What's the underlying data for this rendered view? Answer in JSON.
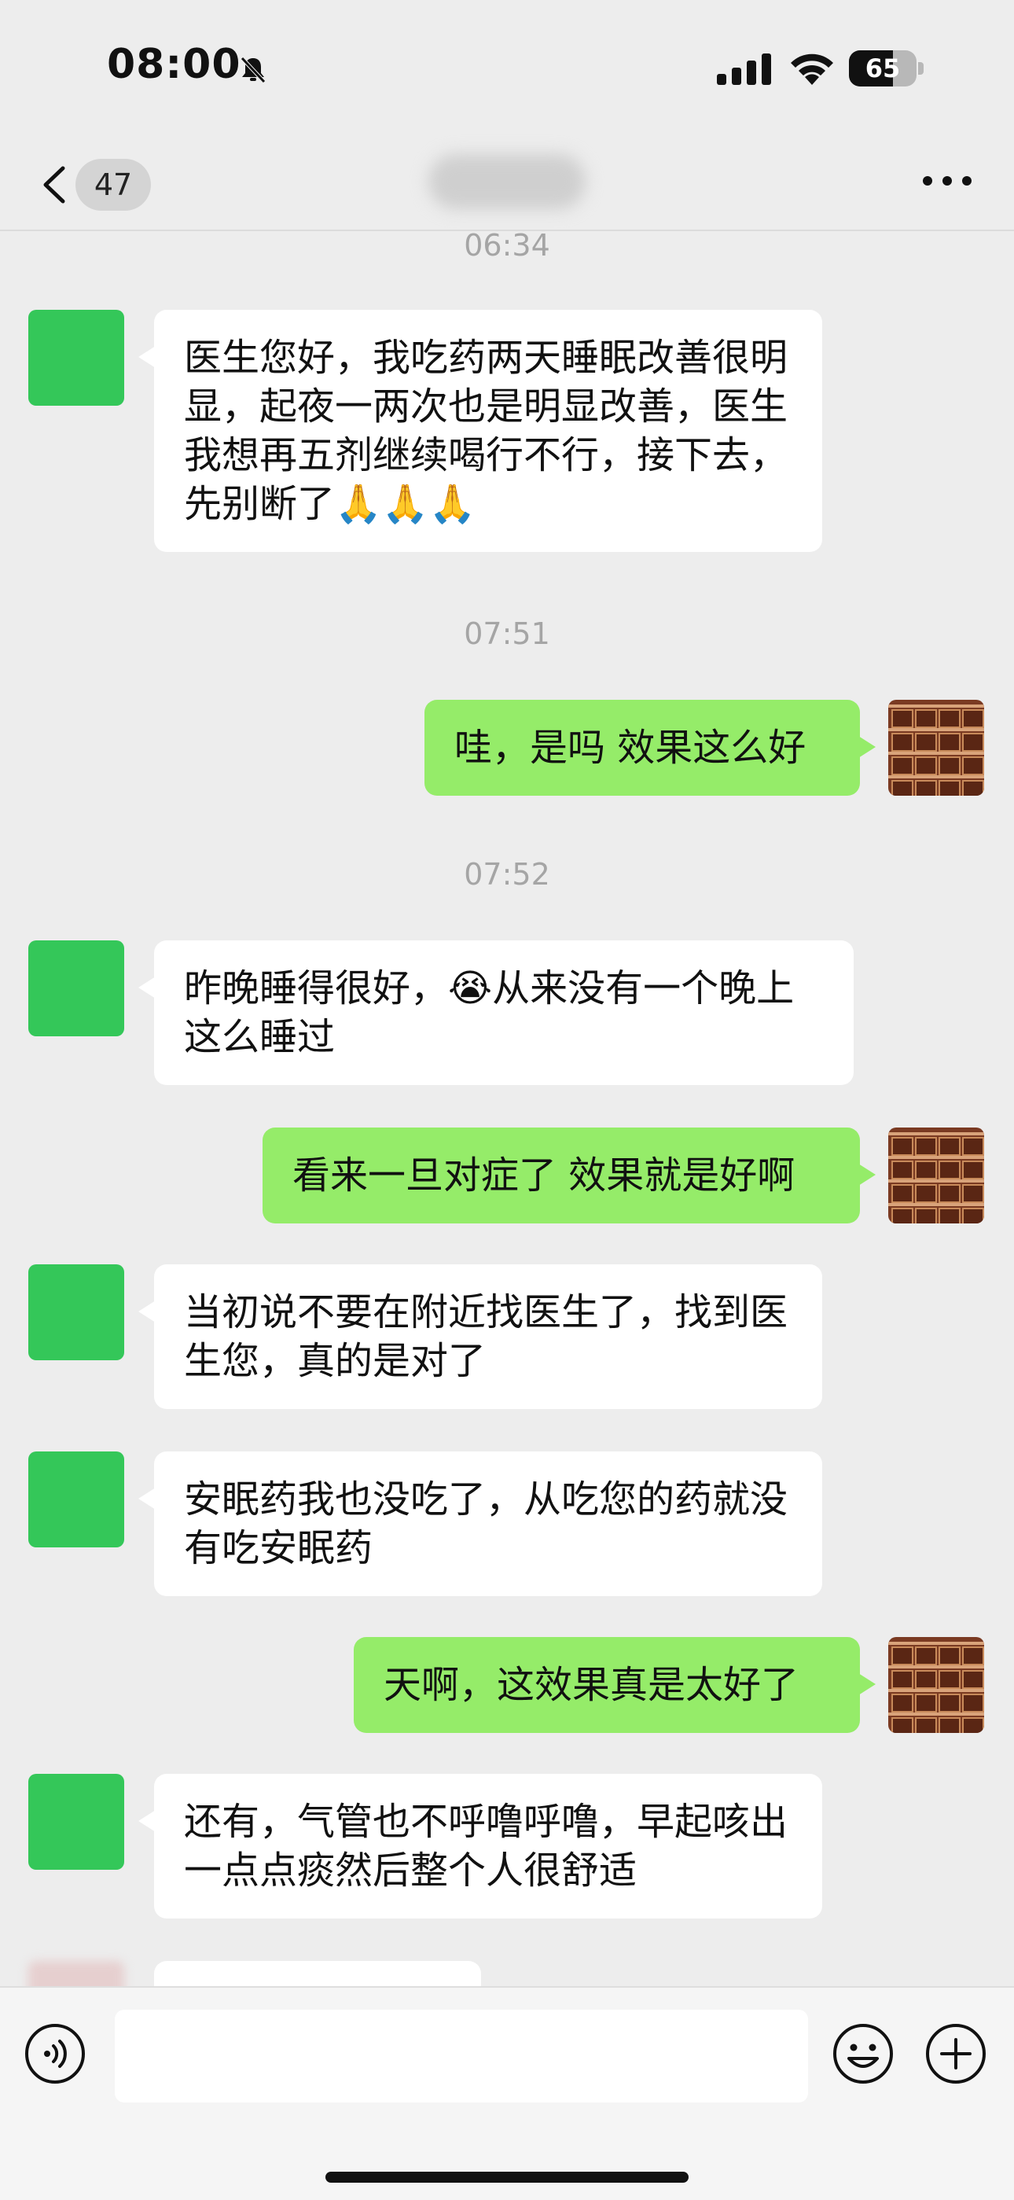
{
  "status_bar": {
    "time": "08:00",
    "battery_percent": "65",
    "battery_level": 0.65,
    "icons": [
      "bell-muted-icon",
      "cellular-signal-icon",
      "wifi-icon",
      "battery-icon"
    ]
  },
  "nav": {
    "unread_count": "47",
    "icons": [
      "chevron-left-icon",
      "more-dots-icon"
    ]
  },
  "colors": {
    "background": "#ededed",
    "outgoing_bubble": "#95ec69",
    "incoming_bubble": "#ffffff",
    "incoming_avatar": "#34c759"
  },
  "messages": [
    {
      "type": "time",
      "text": "06:34"
    },
    {
      "type": "incoming",
      "text": "医生您好，我吃药两天睡眠改善很明显，起夜一两次也是明显改善，医生我想再五剂继续喝行不行，接下去，先别断了🙏🙏🙏"
    },
    {
      "type": "time",
      "text": "07:51"
    },
    {
      "type": "outgoing",
      "text": "哇，是吗 效果这么好"
    },
    {
      "type": "time",
      "text": "07:52"
    },
    {
      "type": "incoming",
      "text": "昨晚睡得很好，😭从来没有一个晚上这么睡过"
    },
    {
      "type": "outgoing",
      "text": "看来一旦对症了 效果就是好啊"
    },
    {
      "type": "incoming",
      "text": "当初说不要在附近找医生了，找到医生您，真的是对了"
    },
    {
      "type": "incoming",
      "text": "安眠药我也没吃了，从吃您的药就没有吃安眠药"
    },
    {
      "type": "outgoing",
      "text": "天啊，这效果真是太好了"
    },
    {
      "type": "incoming",
      "text": "还有，气管也不呼噜呼噜，早起咳出一点点痰然后整个人很舒适"
    }
  ],
  "input_bar": {
    "placeholder": "",
    "icons": [
      "voice-icon",
      "emoji-icon",
      "plus-icon"
    ]
  }
}
